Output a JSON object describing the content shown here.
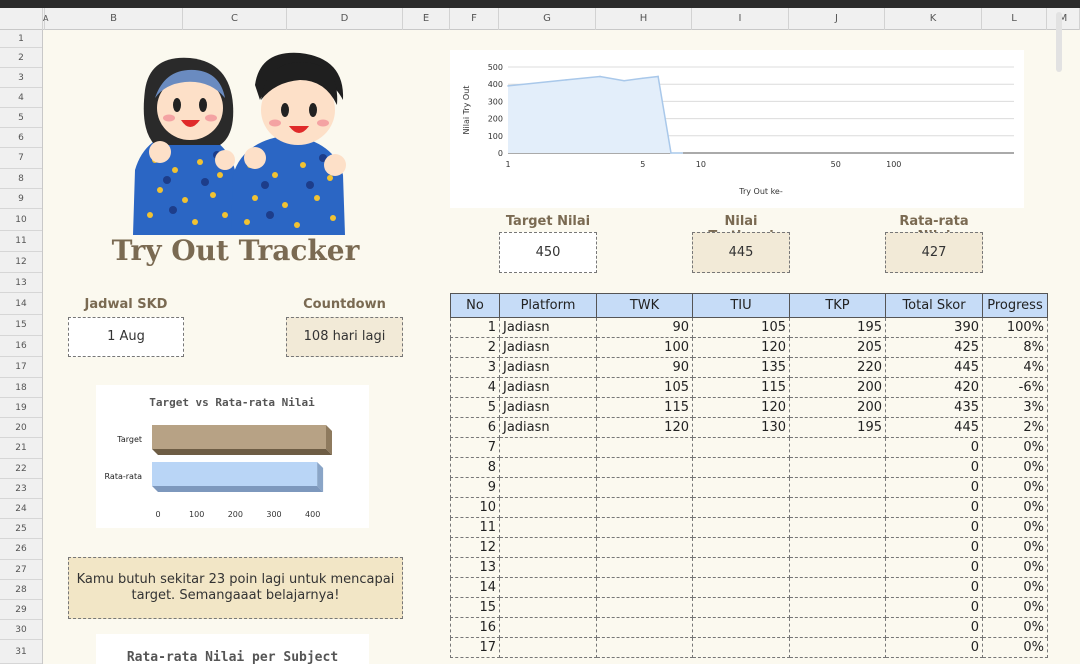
{
  "columns": [
    "A",
    "B",
    "C",
    "D",
    "E",
    "F",
    "G",
    "H",
    "I",
    "J",
    "K",
    "L",
    "M"
  ],
  "rows": [
    "1",
    "2",
    "3",
    "4",
    "5",
    "6",
    "7",
    "8",
    "9",
    "10",
    "11",
    "12",
    "13",
    "14",
    "15",
    "16",
    "17",
    "18",
    "19",
    "20",
    "21",
    "22",
    "23",
    "24",
    "25",
    "26",
    "27",
    "28",
    "29",
    "30",
    "31"
  ],
  "title": "Try Out Tracker",
  "jadwal": {
    "label": "Jadwal SKD",
    "value": "1 Aug"
  },
  "countdown": {
    "label": "Countdown",
    "value": "108 hari lagi"
  },
  "target": {
    "label": "Target Nilai",
    "value": "450"
  },
  "tertinggi": {
    "label": "Nilai Tertinggi",
    "value": "445"
  },
  "ratarata": {
    "label": "Rata-rata Nilai",
    "value": "427"
  },
  "message": "Kamu butuh sekitar 23 poin lagi untuk mencapai target. Semangaaat belajarnya!",
  "subject_chart_title": "Rata-rata Nilai per Subject",
  "table": {
    "headers": [
      "No",
      "Platform",
      "TWK",
      "TIU",
      "TKP",
      "Total Skor",
      "Progress"
    ],
    "rows": [
      [
        "1",
        "Jadiasn",
        "90",
        "105",
        "195",
        "390",
        "100%"
      ],
      [
        "2",
        "Jadiasn",
        "100",
        "120",
        "205",
        "425",
        "8%"
      ],
      [
        "3",
        "Jadiasn",
        "90",
        "135",
        "220",
        "445",
        "4%"
      ],
      [
        "4",
        "Jadiasn",
        "105",
        "115",
        "200",
        "420",
        "-6%"
      ],
      [
        "5",
        "Jadiasn",
        "115",
        "120",
        "200",
        "435",
        "3%"
      ],
      [
        "6",
        "Jadiasn",
        "120",
        "130",
        "195",
        "445",
        "2%"
      ],
      [
        "7",
        "",
        "",
        "",
        "",
        "0",
        "0%"
      ],
      [
        "8",
        "",
        "",
        "",
        "",
        "0",
        "0%"
      ],
      [
        "9",
        "",
        "",
        "",
        "",
        "0",
        "0%"
      ],
      [
        "10",
        "",
        "",
        "",
        "",
        "0",
        "0%"
      ],
      [
        "11",
        "",
        "",
        "",
        "",
        "0",
        "0%"
      ],
      [
        "12",
        "",
        "",
        "",
        "",
        "0",
        "0%"
      ],
      [
        "13",
        "",
        "",
        "",
        "",
        "0",
        "0%"
      ],
      [
        "14",
        "",
        "",
        "",
        "",
        "0",
        "0%"
      ],
      [
        "15",
        "",
        "",
        "",
        "",
        "0",
        "0%"
      ],
      [
        "16",
        "",
        "",
        "",
        "",
        "0",
        "0%"
      ],
      [
        "17",
        "",
        "",
        "",
        "",
        "0",
        "0%"
      ]
    ]
  },
  "chart_data": [
    {
      "type": "area",
      "title": "",
      "xlabel": "Try Out ke-",
      "ylabel": "Nilai Try Out",
      "xscale": "log",
      "x_ticks": [
        "1",
        "5",
        "10",
        "50",
        "100"
      ],
      "y_ticks": [
        "0",
        "100",
        "200",
        "300",
        "400",
        "500"
      ],
      "ylim": [
        0,
        500
      ],
      "x": [
        1,
        2,
        3,
        4,
        5,
        6,
        7,
        8
      ],
      "values": [
        390,
        425,
        445,
        420,
        435,
        445,
        0,
        0
      ],
      "color": "#a9c8ea",
      "fill": "#e3eefa"
    },
    {
      "type": "bar",
      "orientation": "horizontal",
      "title": "Target vs Rata-rata Nilai",
      "categories": [
        "Target",
        "Rata-rata"
      ],
      "values": [
        450,
        427
      ],
      "colors": [
        "#b7a285",
        "#b9d5f6"
      ],
      "x_ticks": [
        "0",
        "100",
        "200",
        "300",
        "400"
      ],
      "xlim": [
        0,
        450
      ]
    }
  ]
}
